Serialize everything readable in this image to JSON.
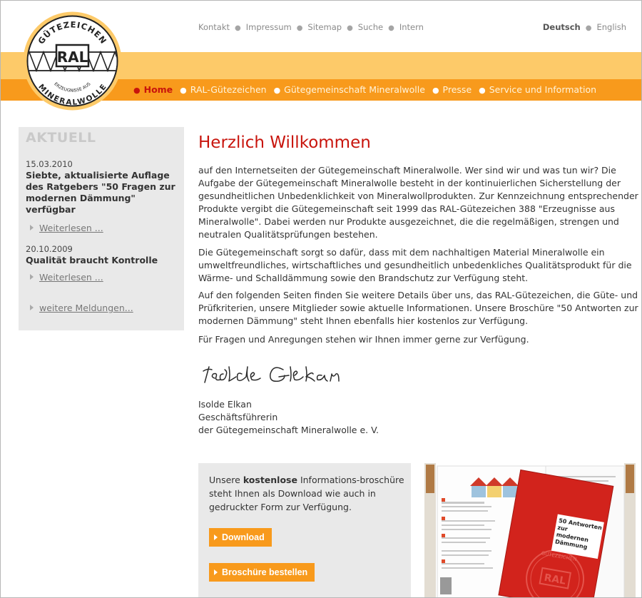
{
  "logo": {
    "top_text": "GÜTEZEICHEN",
    "center_text": "RAL",
    "small_text": "ERZEUGNISSE AUS",
    "bottom_text": "MINERALWOLLE"
  },
  "top_links": [
    "Kontakt",
    "Impressum",
    "Sitemap",
    "Suche",
    "Intern"
  ],
  "languages": {
    "active": "Deutsch",
    "other": "English"
  },
  "nav": [
    {
      "label": "Home",
      "active": true
    },
    {
      "label": "RAL-Gütezeichen"
    },
    {
      "label": "Gütegemeinschaft Mineralwolle"
    },
    {
      "label": "Presse"
    },
    {
      "label": "Service und Information"
    }
  ],
  "sidebar": {
    "heading": "AKTUELL",
    "news": [
      {
        "date": "15.03.2010",
        "title": "Siebte, aktualisierte Auflage des Ratgebers \"50 Fragen zur modernen Dämmung\" verfügbar",
        "link": "Weiterlesen ..."
      },
      {
        "date": "20.10.2009",
        "title": "Qualität braucht Kontrolle",
        "link": "Weiterlesen ..."
      }
    ],
    "more_link": "weitere Meldungen..."
  },
  "main": {
    "title": "Herzlich Willkommen",
    "paragraphs": [
      "auf den Internetseiten der Gütegemeinschaft Mineralwolle. Wer sind wir und was tun wir? Die Aufgabe der Gütegemeinschaft Mineralwolle besteht in der kontinuierlichen Sicherstellung der gesundheitlichen Unbedenklichkeit von Mineralwollprodukten. Zur Kennzeichnung entsprechender Produkte vergibt die Gütegemeinschaft seit 1999 das RAL-Gütezeichen 388 \"Erzeugnisse aus Mineralwolle\". Dabei werden nur Produkte ausgezeichnet, die die regelmäßigen, strengen und neutralen Qualitätsprüfungen bestehen.",
      "Die Gütegemeinschaft sorgt so dafür, dass mit dem nachhaltigen Material Mineralwolle ein umweltfreundliches, wirtschaftliches und gesundheitlich unbedenkliches Qualitätsprodukt für die Wärme- und Schalldämmung sowie den Brandschutz zur Verfügung steht.",
      "Auf den folgenden Seiten finden Sie weitere Details über uns, das RAL-Gütezeichen, die Güte- und Prüfkriterien, unsere Mitglieder sowie aktuelle Informationen. Unsere Broschüre \"50 Antworten zur modernen Dämmung\" steht Ihnen ebenfalls hier kostenlos zur Verfügung.",
      "Für Fragen und Anregungen stehen wir Ihnen immer gerne zur Verfügung."
    ],
    "signature_script": "Isolde Elkan",
    "signer_name": "Isolde Elkan",
    "signer_role": "Geschäftsführerin",
    "signer_org": "der Gütegemeinschaft Mineralwolle e. V."
  },
  "promo": {
    "text_before": "Unsere ",
    "text_bold": "kostenlose",
    "text_after": " Informations-broschüre steht Ihnen als Download wie auch in gedruckter Form zur Verfügung.",
    "download_label": "Download",
    "order_label": "Broschüre bestellen"
  },
  "brochure": {
    "cover_title": "50 Antworten zur modernen Dämmung",
    "seal_text": "GÜTEZEICHEN",
    "seal_center": "RAL"
  },
  "colors": {
    "accent_red": "#c8140c",
    "orange_dark": "#f89a1c",
    "orange_light": "#fdca69",
    "sidebar_gray": "#e9e9e9"
  }
}
